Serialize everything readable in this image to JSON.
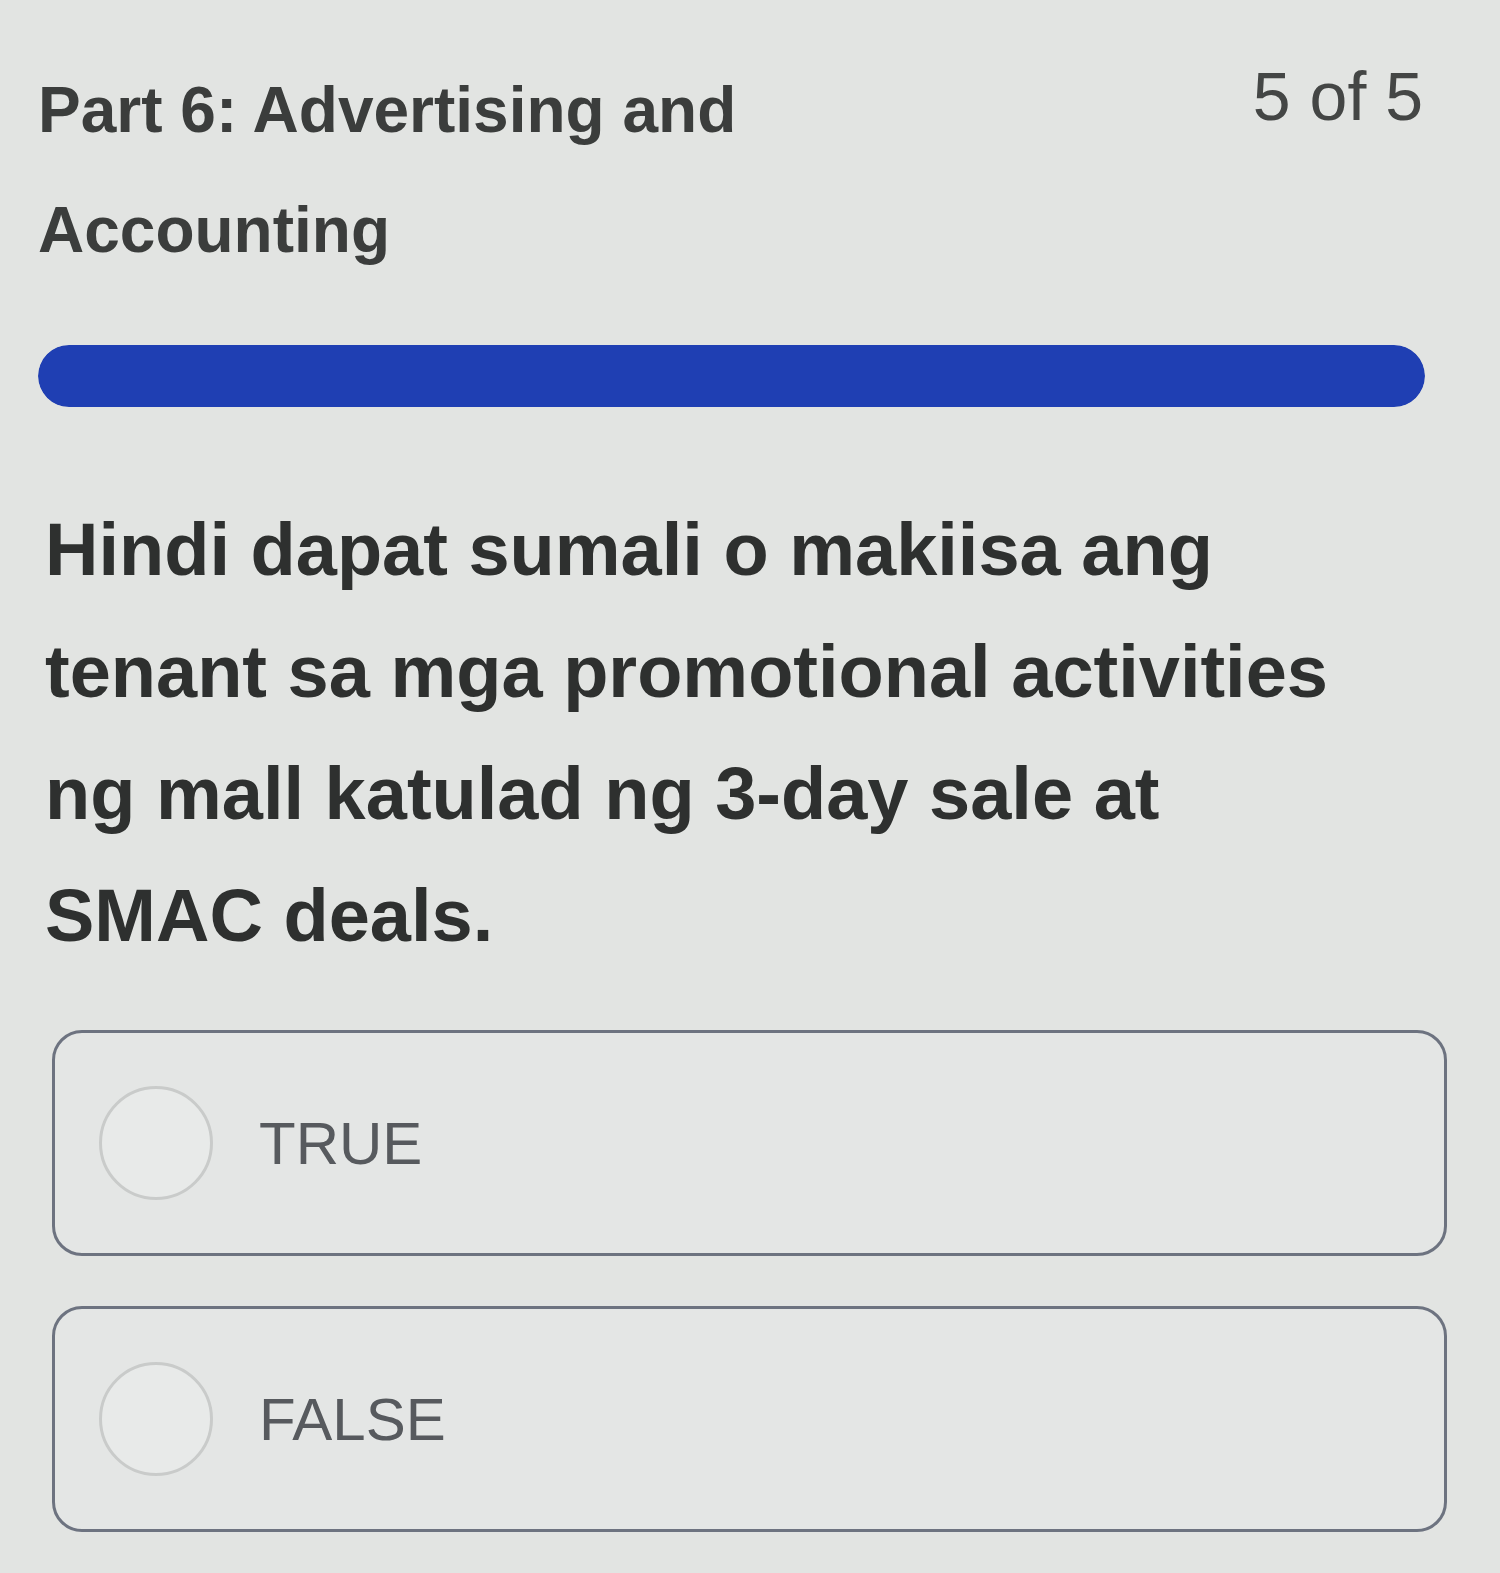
{
  "header": {
    "title": "Part 6: Advertising and Accounting",
    "counter": "5 of 5"
  },
  "progress": {
    "level": 1
  },
  "question": {
    "text": "Hindi dapat sumali o makiisa ang tenant sa mga promotional activities ng mall katulad ng 3-day sale at SMAC deals."
  },
  "options": [
    {
      "label": "TRUE",
      "selected": false
    },
    {
      "label": "FALSE",
      "selected": false
    }
  ]
}
